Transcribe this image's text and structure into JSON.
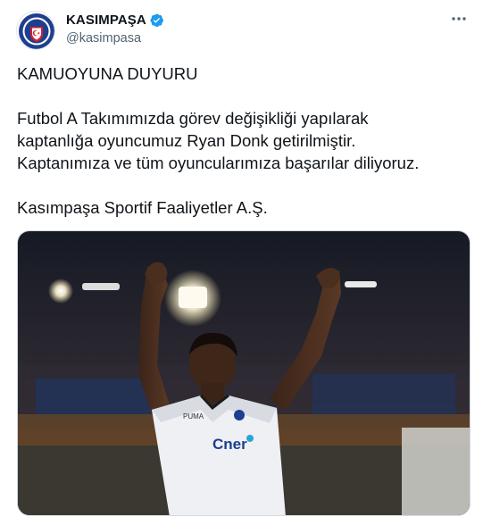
{
  "account": {
    "display_name": "KASIMPAŞA",
    "handle": "@kasimpasa",
    "verified_icon": "verified-badge-icon",
    "avatar_icon": "club-crest-icon"
  },
  "tweet": {
    "headline": "KAMUOYUNA DUYURU",
    "paragraph_lines": [
      "Futbol A Takımımızda görev değişikliği yapılarak",
      "kaptanlığa oyuncumuz Ryan Donk getirilmiştir.",
      "Kaptanımıza ve tüm oyuncularımıza başarılar diliyoruz."
    ],
    "signature": "Kasımpaşa Sportif Faaliyetler A.Ş."
  },
  "media": {
    "description_icon": "photo-player-celebrating",
    "jersey_sponsor": "Cner"
  },
  "colors": {
    "verified": "#1d9bf0",
    "text": "#0f1419",
    "muted": "#536471",
    "club_blue": "#1e3f8f",
    "club_red": "#d32030"
  }
}
